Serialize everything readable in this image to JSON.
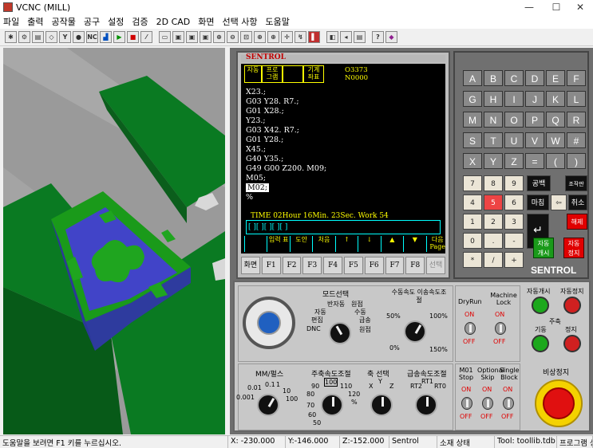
{
  "window": {
    "title": "VCNC (MILL)",
    "minimize": "—",
    "maximize": "☐",
    "close": "✕"
  },
  "menu": [
    "파일",
    "출력",
    "공작물",
    "공구",
    "설정",
    "검증",
    "2D CAD",
    "화면",
    "선택 사항",
    "도움말"
  ],
  "toolbar": {
    "buttons": [
      "new-icon",
      "open-icon",
      "save-icon",
      "workpiece-icon",
      "tool-icon",
      "nc-icon",
      "chart-icon",
      "play-icon",
      "stop-icon",
      "edit-icon",
      "view1-icon",
      "view2-icon",
      "view3-icon",
      "view4-icon",
      "zoom-in-icon",
      "zoom-out-icon",
      "zoom-window-icon",
      "zoom-all-icon",
      "zoom-fit-icon",
      "pan-icon",
      "rotate-icon",
      "color-icon",
      "sound-icon",
      "info-icon",
      "help-icon",
      "book-icon"
    ],
    "nc_label": "NC"
  },
  "nc_screen": {
    "brand": "SENTROL",
    "status_cells": [
      "자동",
      "프로 그램",
      "",
      "기계 좌표"
    ],
    "program_number": "O3373",
    "sequence_number": "N0000",
    "program_lines": [
      "X23.;",
      "G03 Y28. R7.;",
      "G01 X28.;",
      "Y23.;",
      "G03 X42. R7.;",
      "G01 Y28.;",
      "X45.;",
      "G40 Y35.;",
      "G49 G00 Z200. M09;",
      "M05;",
      "M02;",
      "%"
    ],
    "time_text": "TIME  02Hour 16Min. 23Sec.  Work  54",
    "cursor_text": "[  ][  ][  ][  ][  ]",
    "softkeys_top": [
      "",
      "입럭 표",
      "도안",
      "처음",
      "↑",
      "↓",
      "▲",
      "▼",
      "다음 Page"
    ],
    "function_keys": [
      "화면",
      "F1",
      "F2",
      "F3",
      "F4",
      "F5",
      "F6",
      "F7",
      "F8",
      "선택"
    ]
  },
  "keypad": {
    "letters": [
      "A",
      "B",
      "C",
      "D",
      "E",
      "F",
      "G",
      "H",
      "I",
      "J",
      "K",
      "L",
      "M",
      "N",
      "O",
      "P",
      "Q",
      "R",
      "S",
      "T",
      "U",
      "V",
      "W",
      "#",
      "X",
      "Y",
      "Z",
      "=",
      "(",
      ")"
    ],
    "numbers": [
      "7",
      "8",
      "9",
      "4",
      "5",
      "6",
      "1",
      "2",
      "3",
      "0",
      ".",
      "-",
      "*",
      "/",
      "+"
    ],
    "space": "공백",
    "find": "조작판",
    "cancel": "취소",
    "delete": "마침",
    "reset": "해제",
    "cycle_start": "자동 개시",
    "cycle_stop": "자동 정지",
    "brand": "SENTROL"
  },
  "panel": {
    "mode_select": "모드선택",
    "mode_labels": [
      "반자동",
      "원점",
      "자동",
      "수동",
      "편집",
      "급송",
      "DNC",
      "원점"
    ],
    "feed_title": "수동속도 이송속도조절",
    "feed_labels": [
      "50%",
      "100%",
      "0%",
      "150%"
    ],
    "dryrun": "DryRun",
    "machine_lock": "Machine Lock",
    "on": "ON",
    "off": "OFF",
    "auto_start": "자동개시",
    "auto_stop": "자동정지",
    "spindle": "주축",
    "spindle_start": "기동",
    "spindle_stop": "정지",
    "mm_pulse": "MM/펄스",
    "mm_values": [
      "0.01",
      "0.1",
      "1",
      "0.001",
      "10",
      "100"
    ],
    "spindle_override": "주축속도조절",
    "spindle_values": [
      "90",
      "100",
      "110",
      "80",
      "120",
      "70",
      "60",
      "50",
      "%"
    ],
    "axis_select": "축 선택",
    "axes": [
      "X",
      "Y",
      "Z"
    ],
    "rapid_override": "급송속도조절",
    "rapid_values": [
      "RT2",
      "RT1",
      "RT0"
    ],
    "m01": "M01 Stop",
    "optional_skip": "Optional Skip",
    "single_block": "Single Block",
    "estop": "비상정지"
  },
  "status": {
    "help": "도움말을 보려면 F1 키를 누르십시오.",
    "x": "X: -230.000",
    "y": "Y:-146.000",
    "z": "Z:-152.000",
    "controller": "Sentrol",
    "material": "소재 상태",
    "tool": "Tool: toollib.tdb",
    "program": "프로그램 상태"
  }
}
